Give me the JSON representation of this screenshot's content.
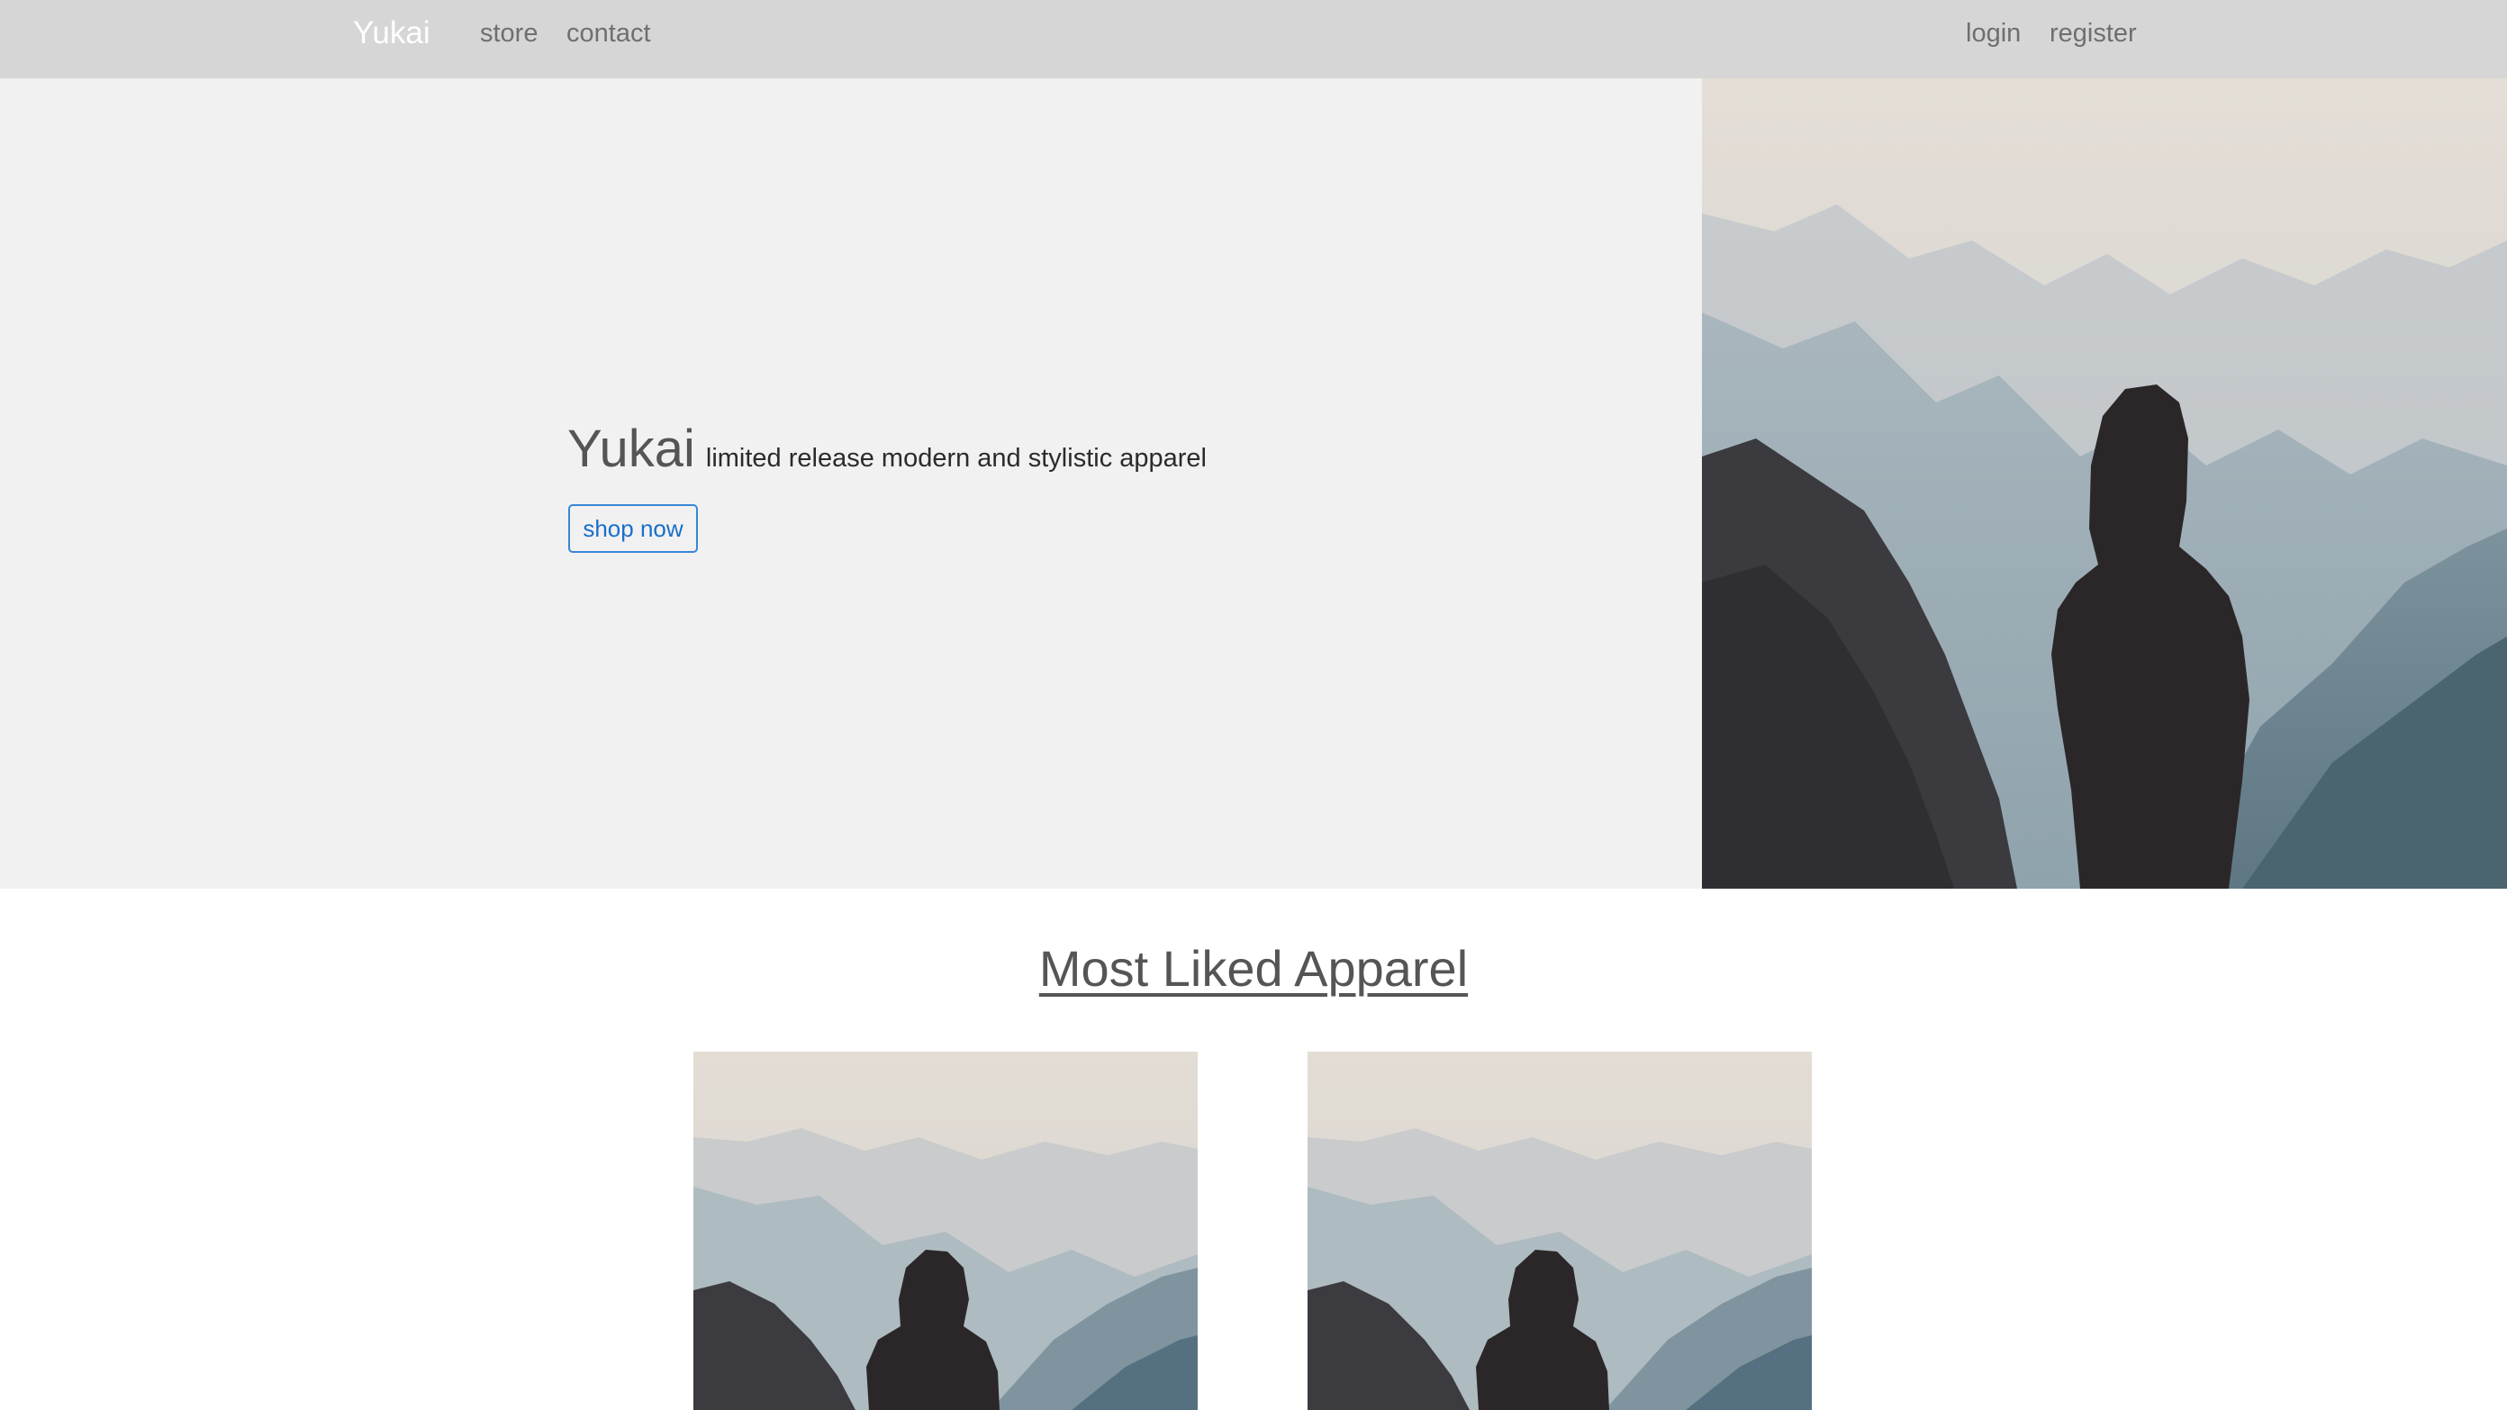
{
  "navbar": {
    "brand": "Yukai",
    "left_links": [
      "store",
      "contact"
    ],
    "right_links": [
      "login",
      "register"
    ]
  },
  "hero": {
    "title": "Yukai",
    "tagline": "limited release modern and stylistic apparel",
    "button_label": "shop now",
    "image_icon": "mountain-hooded-figure-photo"
  },
  "most_liked": {
    "title": "Most Liked Apparel",
    "products": [
      {
        "image_icon": "mountain-hooded-figure-photo"
      },
      {
        "image_icon": "mountain-hooded-figure-photo"
      }
    ]
  },
  "colors": {
    "navbar_bg": "#d6d6d6",
    "hero_bg": "#f1f1f1",
    "button_accent": "#1a6fc9",
    "brand_text": "#ffffff"
  }
}
